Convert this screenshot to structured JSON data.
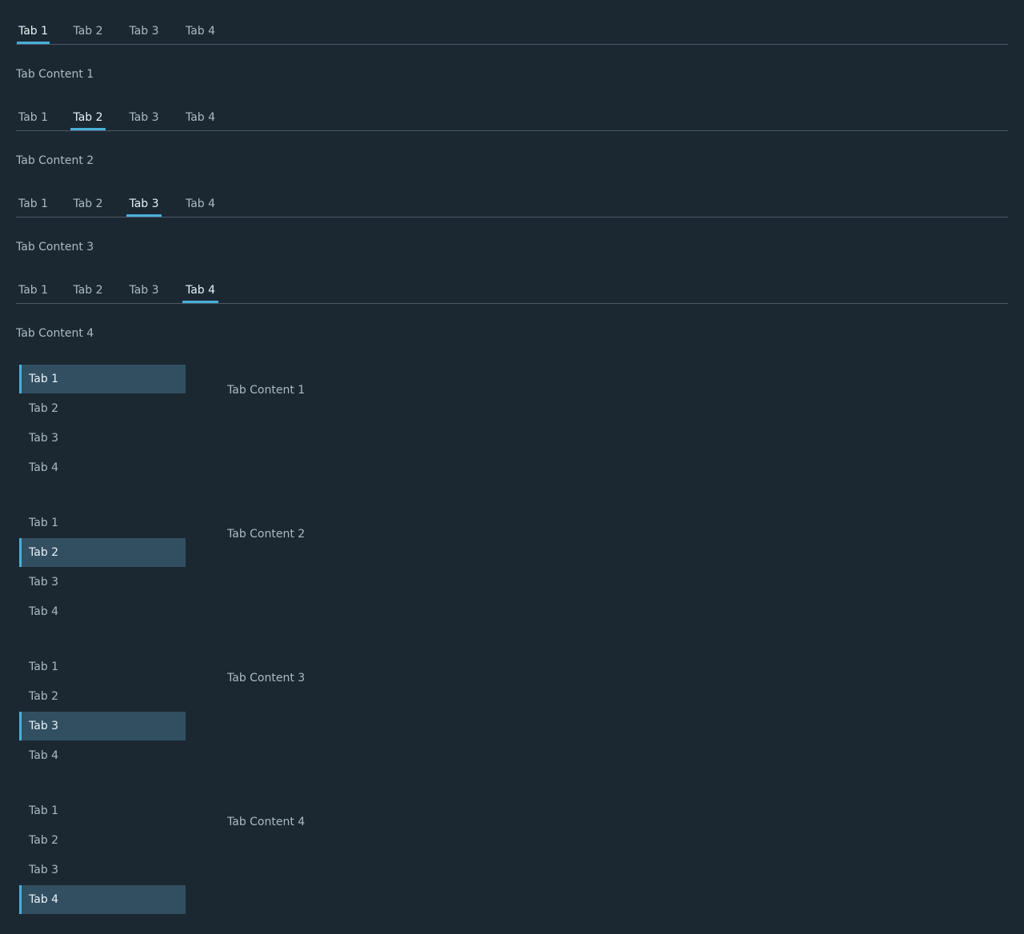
{
  "horizontal_sets": [
    {
      "tabs": [
        "Tab 1",
        "Tab 2",
        "Tab 3",
        "Tab 4"
      ],
      "active": 1,
      "content": "Tab Content 1"
    },
    {
      "tabs": [
        "Tab 1",
        "Tab 2",
        "Tab 3",
        "Tab 4"
      ],
      "active": 2,
      "content": "Tab Content 2"
    },
    {
      "tabs": [
        "Tab 1",
        "Tab 2",
        "Tab 3",
        "Tab 4"
      ],
      "active": 3,
      "content": "Tab Content 3"
    },
    {
      "tabs": [
        "Tab 1",
        "Tab 2",
        "Tab 3",
        "Tab 4"
      ],
      "active": 4,
      "content": "Tab Content 4"
    }
  ],
  "vertical_sets": [
    {
      "tabs": [
        "Tab 1",
        "Tab 2",
        "Tab 3",
        "Tab 4"
      ],
      "active": 1,
      "content": "Tab Content 1"
    },
    {
      "tabs": [
        "Tab 1",
        "Tab 2",
        "Tab 3",
        "Tab 4"
      ],
      "active": 2,
      "content": "Tab Content 2"
    },
    {
      "tabs": [
        "Tab 1",
        "Tab 2",
        "Tab 3",
        "Tab 4"
      ],
      "active": 3,
      "content": "Tab Content 3"
    },
    {
      "tabs": [
        "Tab 1",
        "Tab 2",
        "Tab 3",
        "Tab 4"
      ],
      "active": 4,
      "content": "Tab Content 4"
    }
  ],
  "colors": {
    "background": "#1b2832",
    "text": "#acbac3",
    "active_text": "#eaf2f6",
    "accent": "#49afd9",
    "active_vertical_background": "#324f61",
    "divider": "#495a67"
  }
}
